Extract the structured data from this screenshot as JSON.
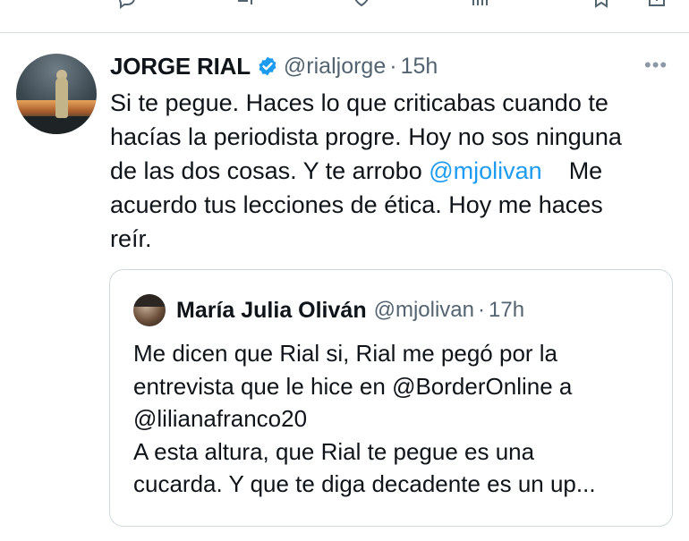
{
  "tweet": {
    "author_name": "JORGE RIAL",
    "handle": "@rialjorge",
    "separator": "·",
    "time": "15h",
    "more_label": "•••",
    "text_lines": [
      "Si te pegue. Haces lo que criticabas cuando te",
      "hacías la periodista progre. Hoy no sos ninguna",
      "de las dos cosas. Y te arrobo "
    ],
    "mention": "@mjolivan",
    "text_after_mention": "    Me",
    "text_lines_end": [
      "acuerdo tus lecciones de ética. Hoy me haces",
      "reír."
    ]
  },
  "quoted_tweet": {
    "author_name": "María Julia Oliván",
    "handle": "@mjolivan",
    "separator": "·",
    "time": "17h",
    "text_lines": [
      "Me dicen que Rial si, Rial me pegó por la",
      "entrevista que le hice en @BorderOnline a",
      "@lilianafranco20",
      "A esta altura, que Rial te pegue es una",
      "cucarda. Y que te diga decadente es un up..."
    ]
  },
  "colors": {
    "link": "#1d9bf0",
    "secondary_text": "#536471",
    "verified_badge": "#1d9bf0",
    "border": "#cfd9de"
  },
  "icons": [
    "reply-icon",
    "retweet-icon",
    "like-icon",
    "views-icon",
    "bookmark-icon",
    "share-icon",
    "verified-badge-icon",
    "more-icon"
  ]
}
